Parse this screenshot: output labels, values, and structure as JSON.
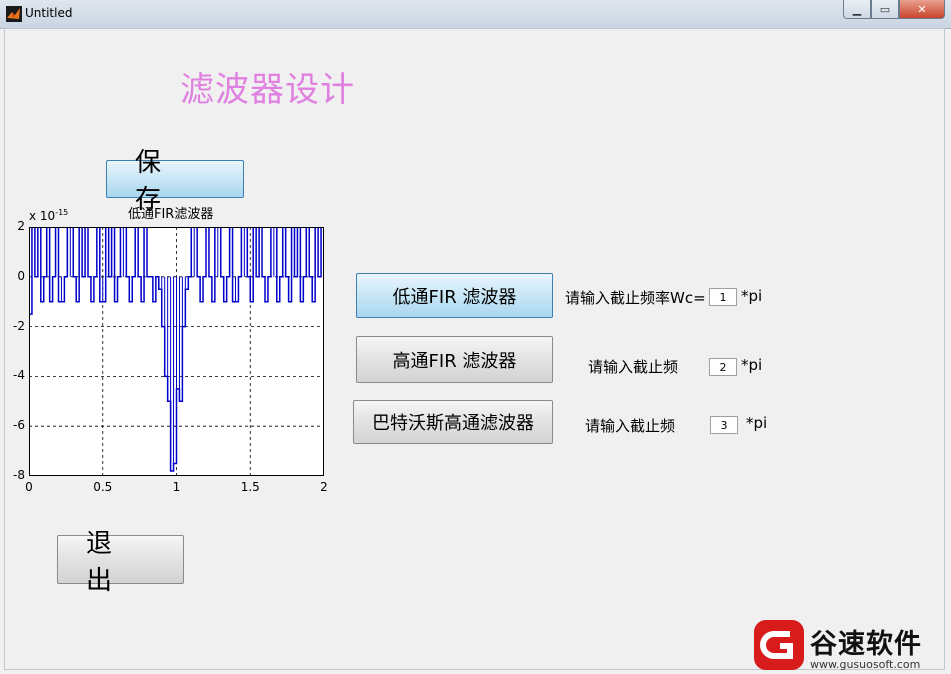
{
  "window": {
    "title": "Untitled"
  },
  "heading": "滤波器设计",
  "buttons": {
    "save": "保存",
    "exit": "退出",
    "lowpass": "低通FIR 滤波器",
    "highpass": "高通FIR 滤波器",
    "butterworth": "巴特沃斯高通滤波器"
  },
  "inputs": {
    "lowpass_label": "请输入截止频率Wc=",
    "lowpass_value": "1",
    "highpass_label": "请输入截止频",
    "highpass_value": "2",
    "butterworth_label": "请输入截止频",
    "butterworth_value": "3",
    "unit": "*pi"
  },
  "chart_data": {
    "type": "line",
    "title": "低通FIR滤波器",
    "exponent_label": "x 10",
    "exponent_power": "-15",
    "xlim": [
      0,
      2
    ],
    "ylim": [
      -8,
      2
    ],
    "xticks": [
      "0",
      "0.5",
      "1",
      "1.5",
      "2"
    ],
    "yticks": [
      "2",
      "0",
      "-2",
      "-4",
      "-6",
      "-8"
    ],
    "grid": true,
    "series_color": "#0000cc",
    "series": [
      {
        "x": [
          0,
          0.02,
          0.04,
          0.06,
          0.08,
          0.1,
          0.12,
          0.14,
          0.16,
          0.18,
          0.2,
          0.22,
          0.24,
          0.26,
          0.28,
          0.3,
          0.32,
          0.34,
          0.36,
          0.38,
          0.4,
          0.42,
          0.44,
          0.46,
          0.48,
          0.5,
          0.52,
          0.54,
          0.56,
          0.58,
          0.6,
          0.62,
          0.64,
          0.66,
          0.68,
          0.7,
          0.72,
          0.74,
          0.76,
          0.78,
          0.8,
          0.82,
          0.84,
          0.86,
          0.88,
          0.9,
          0.92,
          0.94,
          0.96,
          0.98,
          1.0,
          1.02,
          1.04,
          1.06,
          1.08,
          1.1,
          1.12,
          1.14,
          1.16,
          1.18,
          1.2,
          1.22,
          1.24,
          1.26,
          1.28,
          1.3,
          1.32,
          1.34,
          1.36,
          1.38,
          1.4,
          1.42,
          1.44,
          1.46,
          1.48,
          1.5,
          1.52,
          1.54,
          1.56,
          1.58,
          1.6,
          1.62,
          1.64,
          1.66,
          1.68,
          1.7,
          1.72,
          1.74,
          1.76,
          1.78,
          1.8,
          1.82,
          1.84,
          1.86,
          1.88,
          1.9,
          1.92,
          1.94,
          1.96,
          1.98,
          2.0
        ],
        "y": [
          -1.5,
          2,
          0,
          2,
          -1,
          0,
          2,
          -1,
          0,
          2,
          -1,
          -1,
          0,
          2,
          2,
          0,
          -1,
          2,
          0,
          2,
          0,
          -1,
          0,
          2,
          -1,
          -1,
          2,
          0,
          2,
          -1,
          0,
          2,
          2,
          0,
          -1,
          0,
          2,
          0,
          -1,
          2,
          0,
          0,
          -1,
          0,
          -0.5,
          -2,
          -4,
          -5,
          -7.8,
          -7.5,
          -4.5,
          -5,
          -2,
          -0.5,
          0,
          2,
          2,
          0,
          -1,
          0,
          2,
          0,
          -1,
          2,
          2,
          0,
          -1,
          0,
          2,
          -1,
          -1,
          0,
          2,
          2,
          0,
          -1,
          2,
          0,
          2,
          0,
          -1,
          0,
          2,
          2,
          -1,
          0,
          2,
          0,
          -1,
          2,
          0,
          2,
          -1,
          0,
          2,
          0,
          -1,
          2,
          0,
          2,
          -1.8
        ]
      }
    ]
  },
  "watermark": {
    "brand": "谷速软件",
    "url": "www.gusuosoft.com"
  },
  "colors": {
    "heading": "#e080e0",
    "lowpass_button_fill": "#c8e6f6"
  }
}
